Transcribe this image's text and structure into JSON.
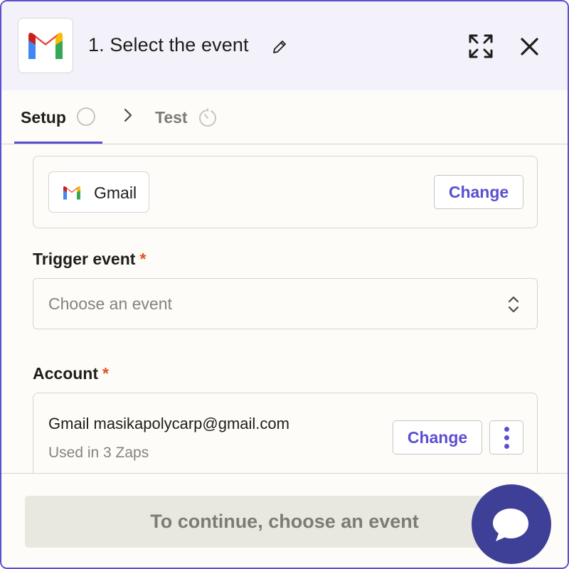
{
  "header": {
    "title": "1. Select the event",
    "app_logo_icon": "gmail-logo-icon",
    "edit_icon": "pencil-icon",
    "expand_icon": "expand-icon",
    "close_icon": "close-icon"
  },
  "tabs": [
    {
      "label": "Setup",
      "status_icon": "circle-icon",
      "active": true
    },
    {
      "label": "Test",
      "status_icon": "timer-icon",
      "active": false
    }
  ],
  "app_section": {
    "app_name": "Gmail",
    "change_label": "Change"
  },
  "trigger_event": {
    "label": "Trigger event",
    "required_mark": "*",
    "placeholder": "Choose an event"
  },
  "account": {
    "label": "Account",
    "required_mark": "*",
    "name": "Gmail masikapolycarp@gmail.com",
    "usage": "Used in 3 Zaps",
    "change_label": "Change",
    "more_icon": "more-vertical-icon"
  },
  "footer": {
    "continue_label": "To continue, choose an event"
  },
  "chat": {
    "icon": "chat-bubble-icon"
  },
  "colors": {
    "accent": "#5b4fd1",
    "required": "#e0541c",
    "header_bg": "#f3f2fa",
    "chat_fab": "#3e3f96"
  }
}
